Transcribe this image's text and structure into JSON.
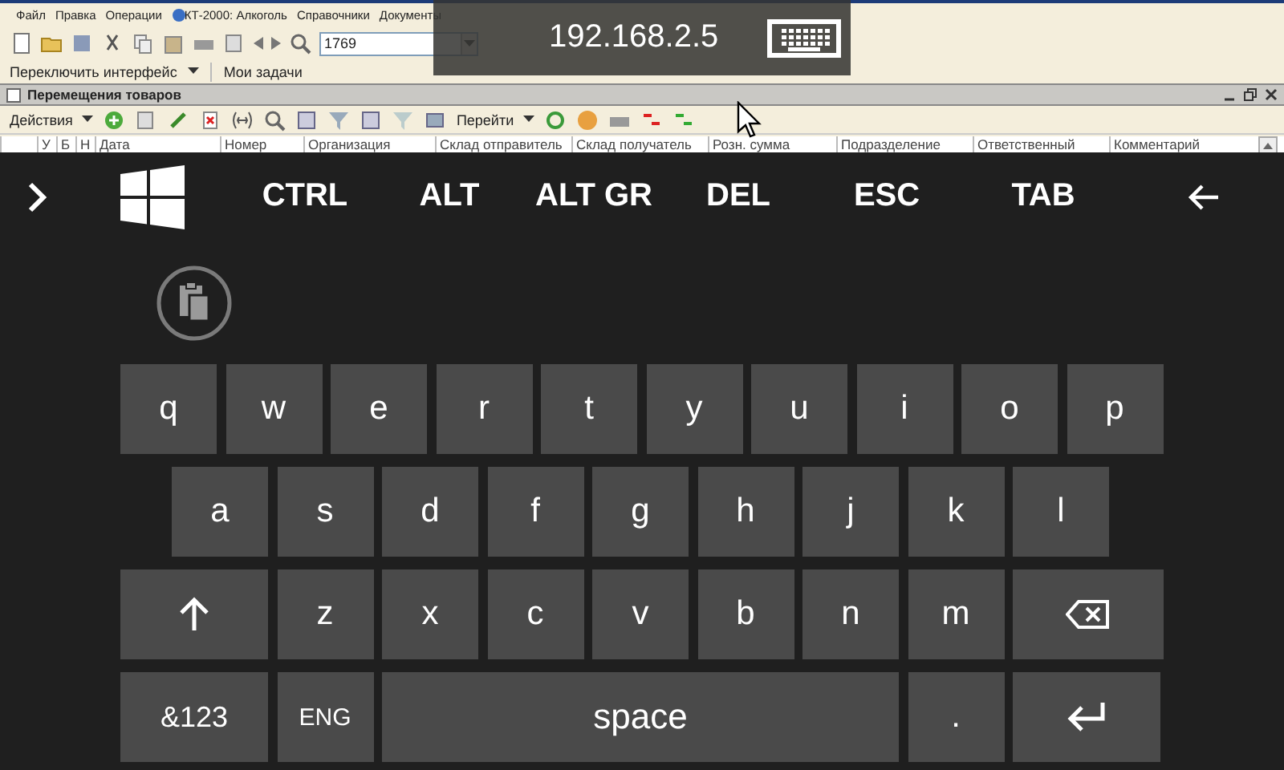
{
  "background_app": {
    "menu": [
      "Файл",
      "Правка",
      "Операции",
      "КТ-2000: Алкоголь",
      "Справочники",
      "Документы"
    ],
    "search_field": {
      "value": "1769"
    },
    "panel_bar": [
      "Переключить интерфейс",
      "Мои задачи"
    ],
    "document_window": {
      "title": "Перемещения товаров",
      "actions": [
        "Действия",
        "Перейти"
      ],
      "columns": [
        "У",
        "Б",
        "Н",
        "Дата",
        "Номер",
        "Организация",
        "Склад отправитель",
        "Склад получатель",
        "Розн. сумма",
        "Подразделение",
        "Ответственный",
        "Комментарий"
      ]
    }
  },
  "connection_bar": {
    "address": "192.168.2.5"
  },
  "keyboard": {
    "function_keys": [
      "CTRL",
      "ALT",
      "ALT GR",
      "DEL",
      "ESC",
      "TAB"
    ],
    "rows": [
      {
        "keys": [
          {
            "kind": "char",
            "label": "q"
          },
          {
            "kind": "char",
            "label": "w"
          },
          {
            "kind": "char",
            "label": "e"
          },
          {
            "kind": "char",
            "label": "r"
          },
          {
            "kind": "char",
            "label": "t"
          },
          {
            "kind": "char",
            "label": "y"
          },
          {
            "kind": "char",
            "label": "u"
          },
          {
            "kind": "char",
            "label": "i"
          },
          {
            "kind": "char",
            "label": "o"
          },
          {
            "kind": "char",
            "label": "p"
          }
        ]
      },
      {
        "keys": [
          {
            "kind": "char",
            "label": "a"
          },
          {
            "kind": "char",
            "label": "s"
          },
          {
            "kind": "char",
            "label": "d"
          },
          {
            "kind": "char",
            "label": "f"
          },
          {
            "kind": "char",
            "label": "g"
          },
          {
            "kind": "char",
            "label": "h"
          },
          {
            "kind": "char",
            "label": "j"
          },
          {
            "kind": "char",
            "label": "k"
          },
          {
            "kind": "char",
            "label": "l"
          }
        ]
      },
      {
        "keys": [
          {
            "kind": "shift"
          },
          {
            "kind": "char",
            "label": "z"
          },
          {
            "kind": "char",
            "label": "x"
          },
          {
            "kind": "char",
            "label": "c"
          },
          {
            "kind": "char",
            "label": "v"
          },
          {
            "kind": "char",
            "label": "b"
          },
          {
            "kind": "char",
            "label": "n"
          },
          {
            "kind": "char",
            "label": "m"
          },
          {
            "kind": "backspace"
          }
        ]
      },
      {
        "keys": [
          {
            "kind": "wide",
            "label": "&123"
          },
          {
            "kind": "char",
            "label": "ENG"
          },
          {
            "kind": "space",
            "label": "space"
          },
          {
            "kind": "char",
            "label": "."
          },
          {
            "kind": "enter"
          }
        ]
      }
    ]
  }
}
